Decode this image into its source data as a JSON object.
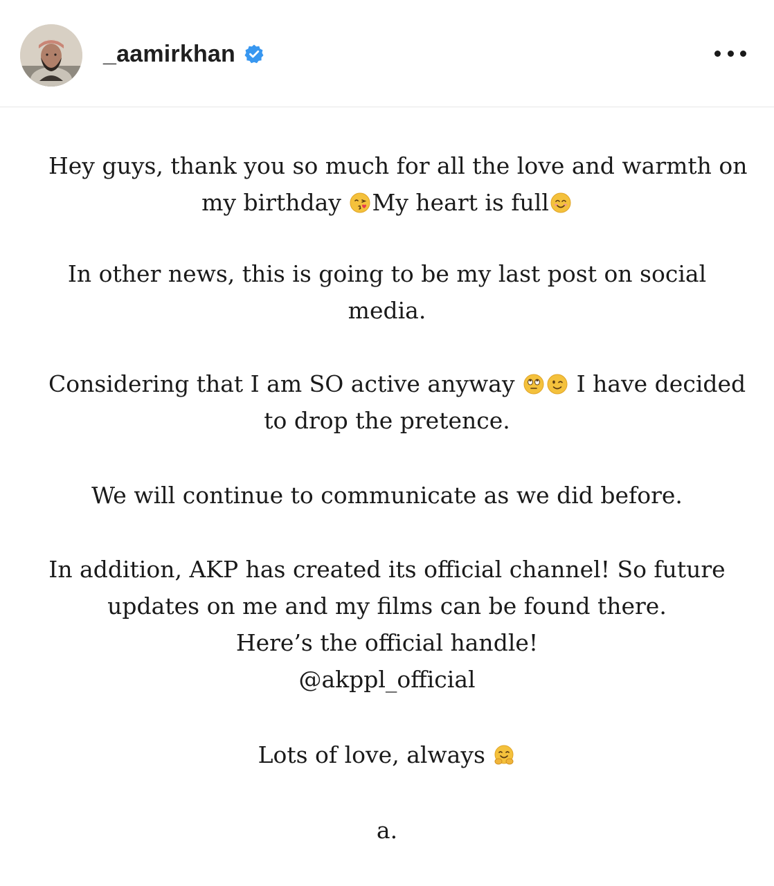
{
  "header": {
    "username": "_aamirkhan",
    "avatar_icon": "profile-photo",
    "verified_icon": "verified-badge-icon",
    "verified_color": "#3897f0",
    "more_icon": "more-options-icon"
  },
  "post": {
    "p1": {
      "line1": "Hey guys, thank you so much for all the love and warmth on",
      "line2a": "my birthday",
      "emoji_kiss": "face-blowing-kiss-emoji",
      "line2b": "My heart is full",
      "emoji_smile": "smiling-face-emoji"
    },
    "p2": {
      "line1": "In other news, this is going to be my last post on social",
      "line2": "media."
    },
    "p3": {
      "line1a": "Considering that I am SO active anyway",
      "emoji_eyeroll": "face-with-rolling-eyes-emoji",
      "emoji_wink": "winking-face-emoji",
      "line1b": "I have decided",
      "line2": "to drop the pretence."
    },
    "p4": {
      "line1": "We will continue to communicate as we did before."
    },
    "p5": {
      "line1": "In addition, AKP has created its official channel! So future",
      "line2": "updates on me and my films can be found there.",
      "line3": "Here’s the official handle!",
      "line4": "@akppl_official"
    },
    "p6": {
      "line1": "Lots of love, always",
      "emoji_hug": "hugging-face-emoji"
    },
    "p7": {
      "signature": "a."
    }
  }
}
